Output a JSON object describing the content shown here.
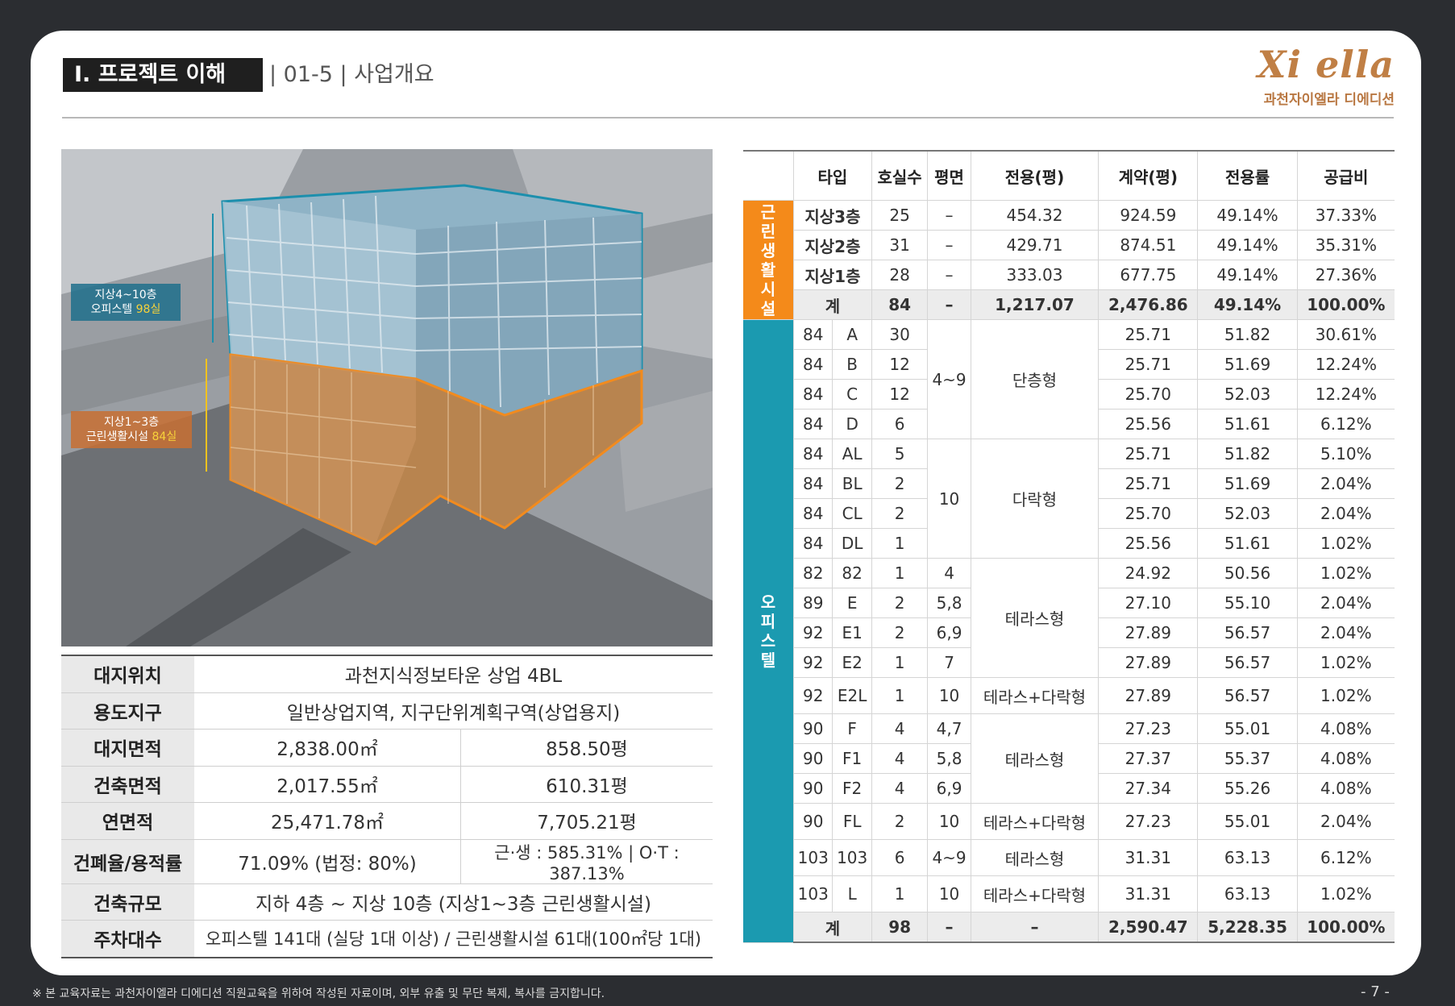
{
  "header": {
    "section_title": "Ⅰ. 프로젝트 이해",
    "subtitle": "| 01-5 | 사업개요",
    "logo_text": "Xi ella",
    "logo_sub": "과천자이엘라 디에디션"
  },
  "image": {
    "upper_tag_line1": "지상4~10층",
    "upper_tag_line2": "오피스텔 ",
    "upper_tag_count": "98실",
    "lower_tag_line1": "지상1~3층",
    "lower_tag_line2": "근린생활시설 ",
    "lower_tag_count": "84실"
  },
  "info": {
    "location_label": "대지위치",
    "location_value": "과천지식정보타운 상업 4BL",
    "zone_label": "용도지구",
    "zone_value": "일반상업지역, 지구단위계획구역(상업용지)",
    "site_label": "대지면적",
    "site_m2": "2,838.00㎡",
    "site_py": "858.50평",
    "building_label": "건축면적",
    "building_m2": "2,017.55㎡",
    "building_py": "610.31평",
    "floor_label": "연면적",
    "floor_m2": "25,471.78㎡",
    "floor_py": "7,705.21평",
    "ratio_label": "건폐율/용적률",
    "ratio_a": "71.09% (법정: 80%)",
    "ratio_b": "근·생 : 585.31% | O·T : 387.13%",
    "scale_label": "건축규모",
    "scale_value": "지하 4층 ~ 지상 10층 (지상1~3층 근린생활시설)",
    "parking_label": "주차대수",
    "parking_value": "오피스텔 141대 (실당 1대 이상) / 근린생활시설 61대(100㎡당 1대)"
  },
  "units": {
    "headers": {
      "type": "타입",
      "count": "호실수",
      "plan": "평면",
      "exclusive": "전용(평)",
      "contract": "계약(평)",
      "ratio": "전용률",
      "supply": "공급비"
    },
    "commercial_label": "근린생활시설",
    "officetel_label": "오피스텔",
    "commercial": [
      {
        "type": "지상3층",
        "count": "25",
        "plan": "–",
        "exclusive": "454.32",
        "contract": "924.59",
        "ratio": "49.14%",
        "supply": "37.33%"
      },
      {
        "type": "지상2층",
        "count": "31",
        "plan": "–",
        "exclusive": "429.71",
        "contract": "874.51",
        "ratio": "49.14%",
        "supply": "35.31%"
      },
      {
        "type": "지상1층",
        "count": "28",
        "plan": "–",
        "exclusive": "333.03",
        "contract": "677.75",
        "ratio": "49.14%",
        "supply": "27.36%"
      }
    ],
    "commercial_sum": {
      "type": "계",
      "count": "84",
      "plan": "–",
      "exclusive": "1,217.07",
      "contract": "2,476.86",
      "ratio": "49.14%",
      "supply": "100.00%"
    },
    "officetel": [
      {
        "a": "84",
        "b": "A",
        "count": "30",
        "c1": "25.71",
        "c2": "51.82",
        "c3": "30.61%"
      },
      {
        "a": "84",
        "b": "B",
        "count": "12",
        "c1": "25.71",
        "c2": "51.69",
        "c3": "12.24%"
      },
      {
        "a": "84",
        "b": "C",
        "count": "12",
        "c1": "25.70",
        "c2": "52.03",
        "c3": "12.24%"
      },
      {
        "a": "84",
        "b": "D",
        "count": "6",
        "c1": "25.56",
        "c2": "51.61",
        "c3": "6.12%"
      },
      {
        "a": "84",
        "b": "AL",
        "count": "5",
        "c1": "25.71",
        "c2": "51.82",
        "c3": "5.10%"
      },
      {
        "a": "84",
        "b": "BL",
        "count": "2",
        "c1": "25.71",
        "c2": "51.69",
        "c3": "2.04%"
      },
      {
        "a": "84",
        "b": "CL",
        "count": "2",
        "c1": "25.70",
        "c2": "52.03",
        "c3": "2.04%"
      },
      {
        "a": "84",
        "b": "DL",
        "count": "1",
        "c1": "25.56",
        "c2": "51.61",
        "c3": "1.02%"
      },
      {
        "a": "82",
        "b": "82",
        "count": "1",
        "plan": "4",
        "c1": "24.92",
        "c2": "50.56",
        "c3": "1.02%"
      },
      {
        "a": "89",
        "b": "E",
        "count": "2",
        "plan": "5,8",
        "c1": "27.10",
        "c2": "55.10",
        "c3": "2.04%"
      },
      {
        "a": "92",
        "b": "E1",
        "count": "2",
        "plan": "6,9",
        "c1": "27.89",
        "c2": "56.57",
        "c3": "2.04%"
      },
      {
        "a": "92",
        "b": "E2",
        "count": "1",
        "plan": "7",
        "c1": "27.89",
        "c2": "56.57",
        "c3": "1.02%"
      },
      {
        "a": "92",
        "b": "E2L",
        "count": "1",
        "plan": "10",
        "kind": "테라스+다락형",
        "c1": "27.89",
        "c2": "56.57",
        "c3": "1.02%"
      },
      {
        "a": "90",
        "b": "F",
        "count": "4",
        "plan": "4,7",
        "c1": "27.23",
        "c2": "55.01",
        "c3": "4.08%"
      },
      {
        "a": "90",
        "b": "F1",
        "count": "4",
        "plan": "5,8",
        "c1": "27.37",
        "c2": "55.37",
        "c3": "4.08%"
      },
      {
        "a": "90",
        "b": "F2",
        "count": "4",
        "plan": "6,9",
        "c1": "27.34",
        "c2": "55.26",
        "c3": "4.08%"
      },
      {
        "a": "90",
        "b": "FL",
        "count": "2",
        "plan": "10",
        "kind": "테라스+다락형",
        "c1": "27.23",
        "c2": "55.01",
        "c3": "2.04%"
      },
      {
        "a": "103",
        "b": "103",
        "count": "6",
        "plan": "4~9",
        "kind": "테라스형",
        "c1": "31.31",
        "c2": "63.13",
        "c3": "6.12%"
      },
      {
        "a": "103",
        "b": "L",
        "count": "1",
        "plan": "10",
        "kind": "테라스+다락형",
        "c1": "31.31",
        "c2": "63.13",
        "c3": "1.02%"
      }
    ],
    "group_plans": {
      "g1": "4~9",
      "g2": "10"
    },
    "group_kinds": {
      "g1": "단층형",
      "g2": "다락형",
      "g3": "테라스형",
      "g4": "테라스형"
    },
    "officetel_sum": {
      "type": "계",
      "count": "98",
      "plan": "–",
      "kind": "–",
      "contract": "2,590.47",
      "ratio": "5,228.35",
      "supply": "100.00%"
    }
  },
  "footer": {
    "note": "※ 본 교육자료는 과천자이엘라 디에디션 직원교육을 위하여 작성된 자료이며, 외부 유출 및 무단 복제, 복사를 금지합니다.",
    "page": "- 7 -"
  }
}
